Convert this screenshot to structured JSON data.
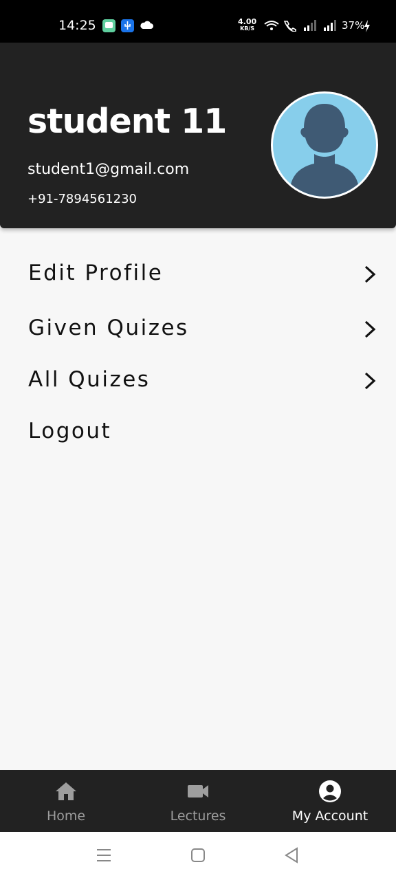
{
  "status_bar": {
    "time": "14:25",
    "net_speed_value": "4.00",
    "net_speed_unit": "KB/S",
    "battery": "37%",
    "icons": [
      "message-app-icon",
      "usb-icon",
      "cloud-icon",
      "wifi-icon",
      "volte-call-icon",
      "signal-icon",
      "signal-icon",
      "charging-icon"
    ]
  },
  "profile": {
    "name": "student 11",
    "email": "student1@gmail.com",
    "phone": "+91-7894561230",
    "avatar_bg": "#87CEEB",
    "avatar_fg": "#3f5a74"
  },
  "menu": {
    "items": [
      {
        "label": "Edit Profile",
        "chevron": true
      },
      {
        "label": "Given Quizes",
        "chevron": true
      },
      {
        "label": "All Quizes",
        "chevron": true
      },
      {
        "label": "Logout",
        "chevron": false
      }
    ]
  },
  "bottom_nav": {
    "items": [
      {
        "label": "Home",
        "icon": "home-icon",
        "active": false
      },
      {
        "label": "Lectures",
        "icon": "video-camera-icon",
        "active": false
      },
      {
        "label": "My Account",
        "icon": "account-circle-icon",
        "active": true
      }
    ],
    "active_color": "#ffffff",
    "inactive_color": "#9e9e9e"
  },
  "system_nav": {
    "icons": [
      "menu-lines-icon",
      "home-square-icon",
      "back-triangle-icon"
    ]
  },
  "colors": {
    "header_bg": "#222222",
    "page_bg": "#f7f7f7",
    "text": "#111111"
  }
}
